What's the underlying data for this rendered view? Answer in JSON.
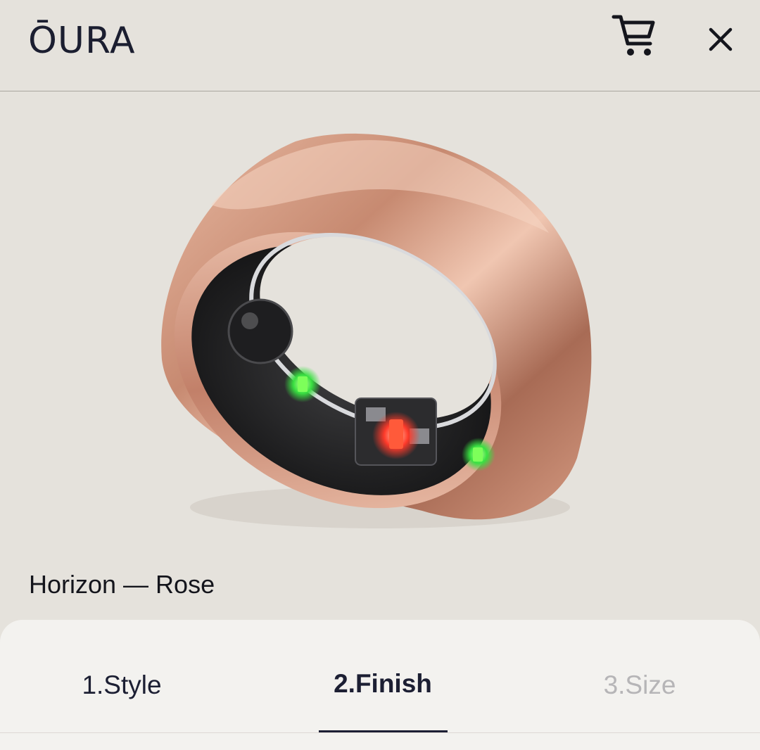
{
  "header": {
    "logo": "ŌURA",
    "icons": {
      "cart": "cart-icon",
      "close": "close-icon"
    }
  },
  "product": {
    "name": "Horizon — Rose",
    "image": "rose-gold-ring-image"
  },
  "steps": {
    "items": [
      {
        "label": "1.Style",
        "state": "done"
      },
      {
        "label": "2.Finish",
        "state": "active"
      },
      {
        "label": "3.Size",
        "state": "upcoming"
      }
    ]
  },
  "colors": {
    "background": "#e5e2dc",
    "panel": "#f3f2ef",
    "text": "#1c1f33",
    "muted": "#b6b5b7",
    "rose_gold": "#c98f77"
  }
}
